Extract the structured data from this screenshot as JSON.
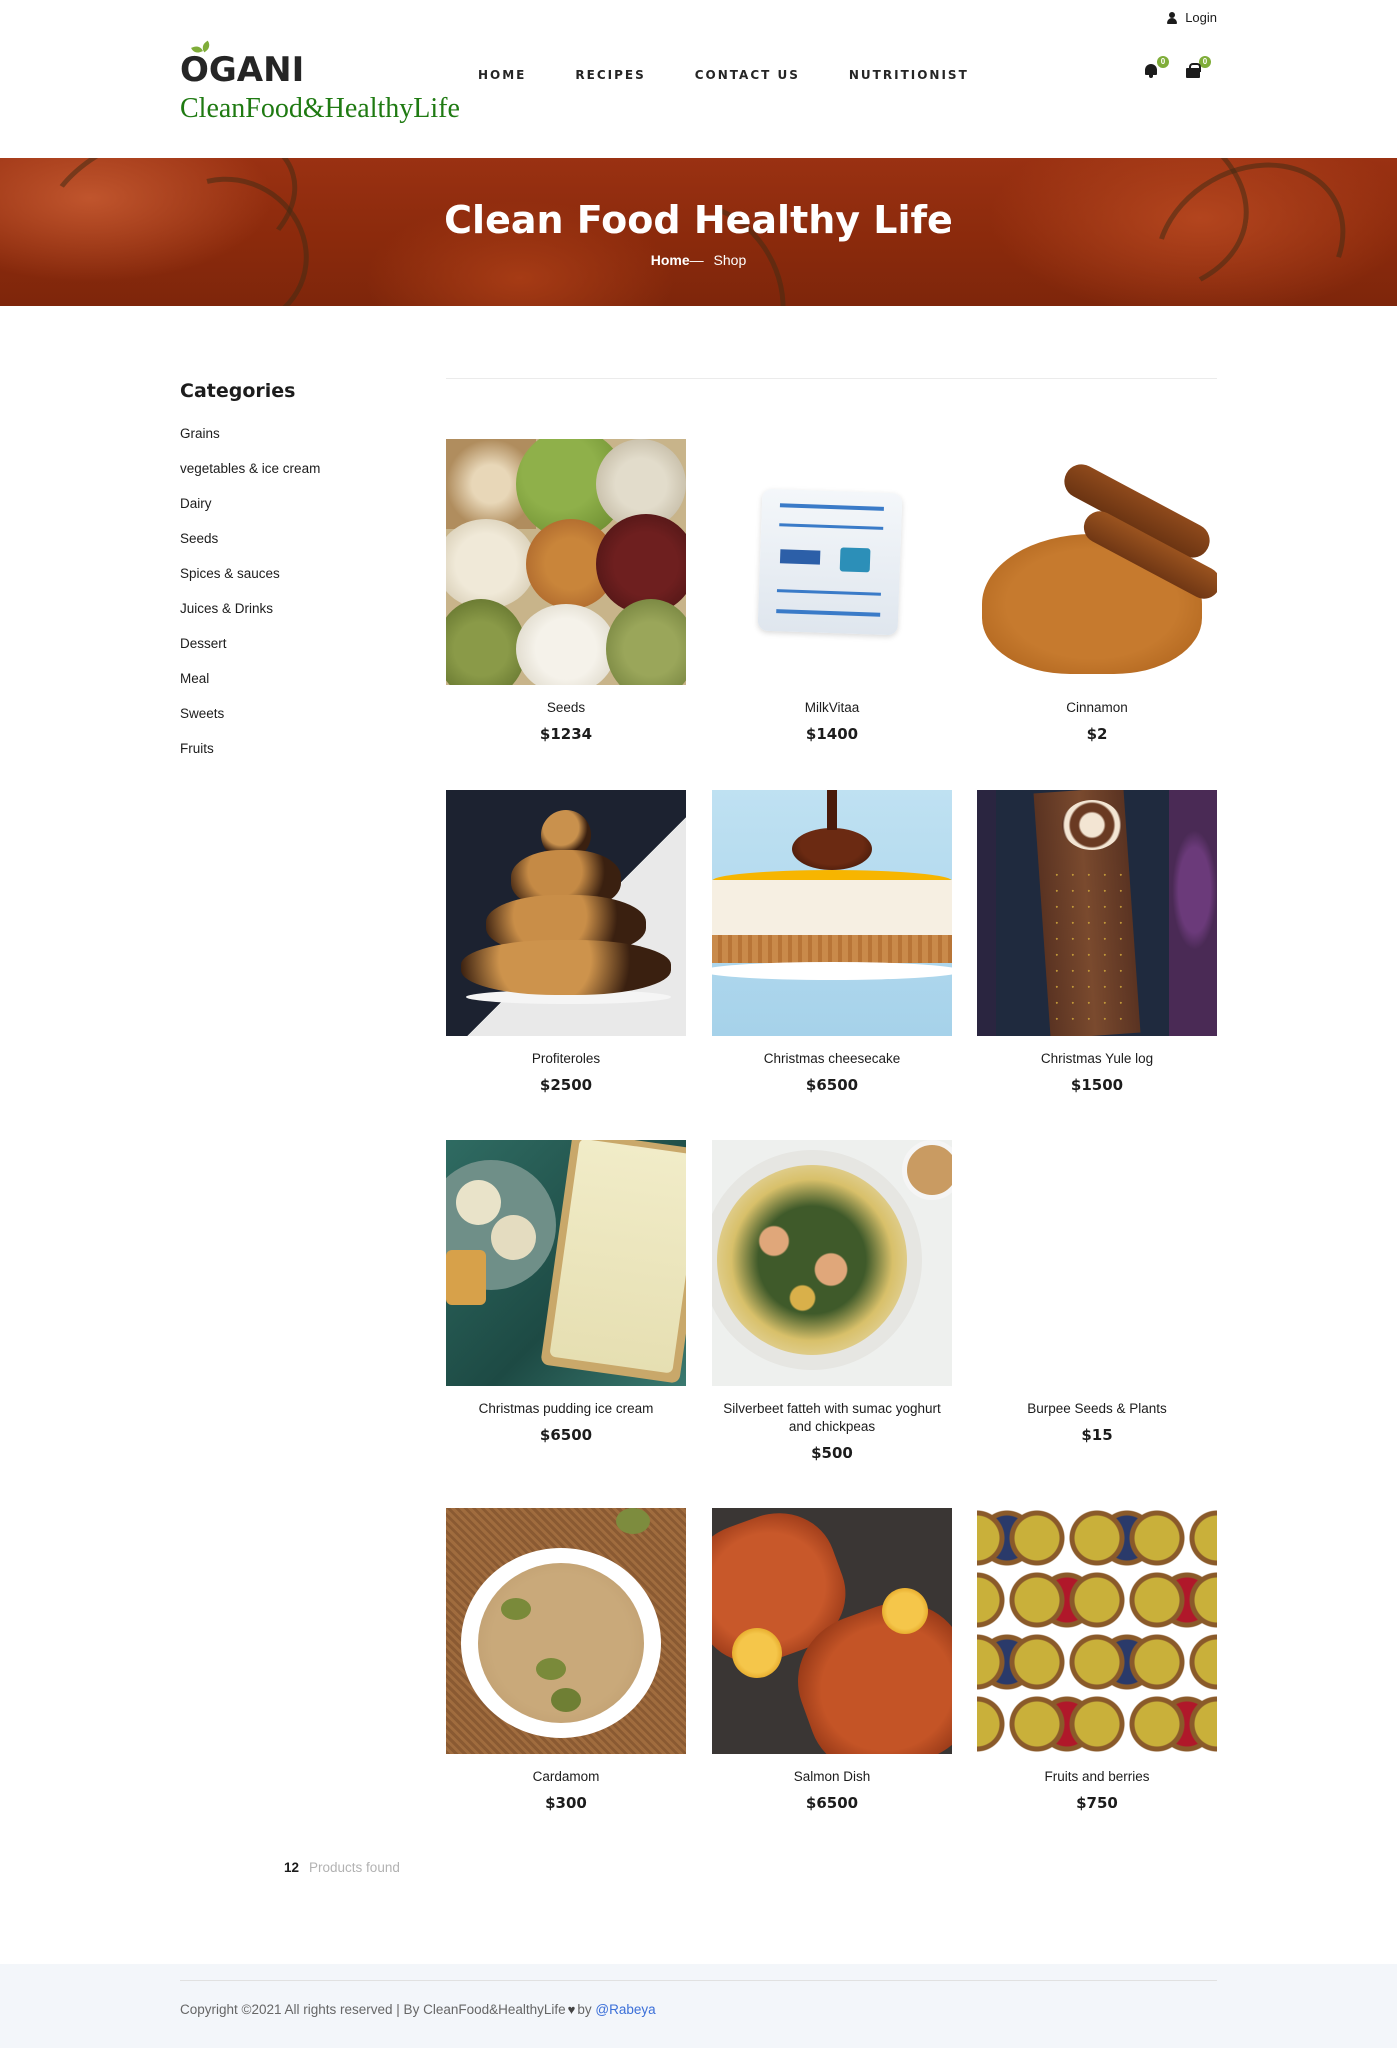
{
  "topbar": {
    "login_label": "Login"
  },
  "header": {
    "logo_text": "OGANI",
    "tagline": "CleanFood&HealthyLife",
    "nav": [
      "HOME",
      "RECIPES",
      "CONTACT US",
      "NUTRITIONIST"
    ],
    "notification_count": "0",
    "cart_count": "0"
  },
  "hero": {
    "title": "Clean Food Healthy Life",
    "breadcrumb_home": "Home",
    "breadcrumb_separator": "—",
    "breadcrumb_current": "Shop"
  },
  "sidebar": {
    "title": "Categories",
    "categories": [
      "Grains",
      "vegetables & ice cream",
      "Dairy",
      "Seeds",
      "Spices & sauces",
      "Juices & Drinks",
      "Dessert",
      "Meal",
      "Sweets",
      "Fruits"
    ]
  },
  "products": [
    {
      "name": "Seeds",
      "price": "$1234",
      "image": "mixed-seeds-image"
    },
    {
      "name": "MilkVitaa",
      "price": "$1400",
      "image": "milk-pack-image"
    },
    {
      "name": "Cinnamon",
      "price": "$2",
      "image": "cinnamon-image"
    },
    {
      "name": "Profiteroles",
      "price": "$2500",
      "image": "profiteroles-image"
    },
    {
      "name": "Christmas cheesecake",
      "price": "$6500",
      "image": "cheesecake-image"
    },
    {
      "name": "Christmas Yule log",
      "price": "$1500",
      "image": "yule-log-image"
    },
    {
      "name": "Christmas pudding ice cream",
      "price": "$6500",
      "image": "ice-cream-image"
    },
    {
      "name": "Silverbeet fatteh with sumac yoghurt and chickpeas",
      "price": "$500",
      "image": "fatteh-image"
    },
    {
      "name": "Burpee Seeds & Plants",
      "price": "$15",
      "image": ""
    },
    {
      "name": "Cardamom",
      "price": "$300",
      "image": "cardamom-image"
    },
    {
      "name": "Salmon Dish",
      "price": "$6500",
      "image": "salmon-image"
    },
    {
      "name": "Fruits and berries",
      "price": "$750",
      "image": "berries-image"
    }
  ],
  "products_found": {
    "count": "12",
    "label": "Products found"
  },
  "footer": {
    "copyright": "Copyright ©2021 All rights reserved | By CleanFood&HealthyLife",
    "by": "by",
    "author": "@Rabeya"
  },
  "colors": {
    "accent": "#7fad39",
    "tagline": "#1f7a12",
    "link": "#3b6fd8",
    "hero": "#8b2a0c"
  },
  "icons": {
    "login": "user-icon",
    "notifications": "bell-icon",
    "cart": "shopping-bag-icon",
    "footer": "heart-icon"
  }
}
